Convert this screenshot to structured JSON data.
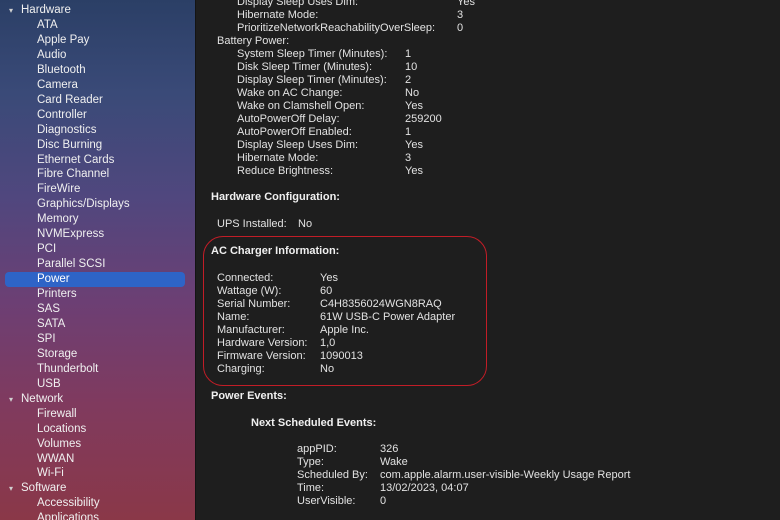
{
  "sidebar": {
    "sections": [
      {
        "label": "Hardware",
        "items": [
          "ATA",
          "Apple Pay",
          "Audio",
          "Bluetooth",
          "Camera",
          "Card Reader",
          "Controller",
          "Diagnostics",
          "Disc Burning",
          "Ethernet Cards",
          "Fibre Channel",
          "FireWire",
          "Graphics/Displays",
          "Memory",
          "NVMExpress",
          "PCI",
          "Parallel SCSI",
          "Power",
          "Printers",
          "SAS",
          "SATA",
          "SPI",
          "Storage",
          "Thunderbolt",
          "USB"
        ]
      },
      {
        "label": "Network",
        "items": [
          "Firewall",
          "Locations",
          "Volumes",
          "WWAN",
          "Wi-Fi"
        ]
      },
      {
        "label": "Software",
        "items": [
          "Accessibility",
          "Applications"
        ]
      }
    ],
    "selected": "Power"
  },
  "main": {
    "top_partial": [
      {
        "k": "Display Sleep Uses Dim:",
        "v": "Yes"
      },
      {
        "k": "Hibernate Mode:",
        "v": "3"
      },
      {
        "k": "PrioritizeNetworkReachabilityOverSleep:",
        "v": "0"
      }
    ],
    "battery_power": {
      "title": "Battery Power:",
      "rows": [
        {
          "k": "System Sleep Timer (Minutes):",
          "v": "1"
        },
        {
          "k": "Disk Sleep Timer (Minutes):",
          "v": "10"
        },
        {
          "k": "Display Sleep Timer (Minutes):",
          "v": "2"
        },
        {
          "k": "Wake on AC Change:",
          "v": "No"
        },
        {
          "k": "Wake on Clamshell Open:",
          "v": "Yes"
        },
        {
          "k": "AutoPowerOff Delay:",
          "v": "259200"
        },
        {
          "k": "AutoPowerOff Enabled:",
          "v": "1"
        },
        {
          "k": "Display Sleep Uses Dim:",
          "v": "Yes"
        },
        {
          "k": "Hibernate Mode:",
          "v": "3"
        },
        {
          "k": "Reduce Brightness:",
          "v": "Yes"
        }
      ]
    },
    "hardware_configuration": {
      "title": "Hardware Configuration:",
      "rows": [
        {
          "k": "UPS Installed:",
          "v": "No"
        }
      ]
    },
    "ac_charger": {
      "title": "AC Charger Information:",
      "rows": [
        {
          "k": "Connected:",
          "v": "Yes"
        },
        {
          "k": "Wattage (W):",
          "v": "60"
        },
        {
          "k": "Serial Number:",
          "v": "C4H8356024WGN8RAQ"
        },
        {
          "k": "Name:",
          "v": "61W USB-C Power Adapter"
        },
        {
          "k": "Manufacturer:",
          "v": "Apple Inc."
        },
        {
          "k": "Hardware Version:",
          "v": "1,0"
        },
        {
          "k": "Firmware Version:",
          "v": "1090013"
        },
        {
          "k": "Charging:",
          "v": "No"
        }
      ]
    },
    "power_events": {
      "title": "Power Events:",
      "next_title": "Next Scheduled Events:",
      "rows": [
        {
          "k": "appPID:",
          "v": "326"
        },
        {
          "k": "Type:",
          "v": "Wake"
        },
        {
          "k": "Scheduled By:",
          "v": "com.apple.alarm.user-visible-Weekly Usage Report"
        },
        {
          "k": "Time:",
          "v": "13/02/2023, 04:07"
        },
        {
          "k": "UserVisible:",
          "v": "0"
        }
      ]
    }
  },
  "colors": {
    "selection": "#2e64c7",
    "highlight_ring": "#c21d27",
    "background": "#1e1e1e"
  }
}
